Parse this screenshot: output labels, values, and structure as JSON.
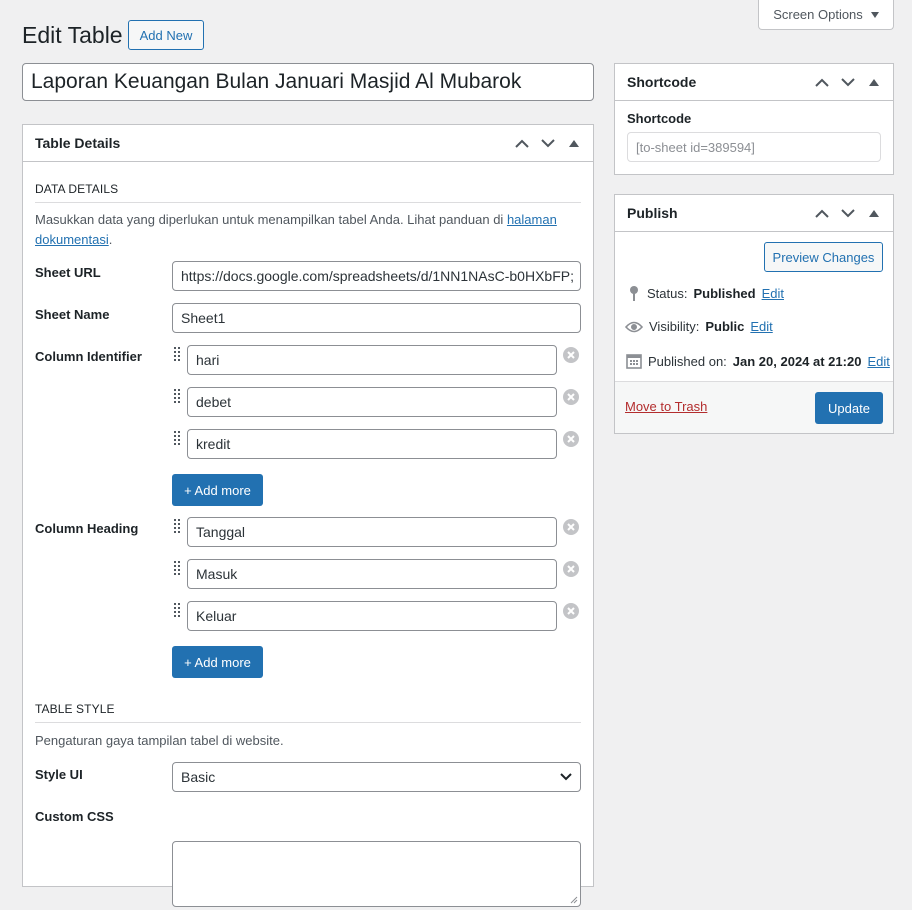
{
  "header": {
    "page_title": "Edit Table",
    "add_new_label": "Add New",
    "screen_options_label": "Screen Options"
  },
  "title_input": {
    "value": "Laporan Keuangan Bulan Januari Masjid Al Mubarok"
  },
  "table_details": {
    "heading": "Table Details",
    "data_details": {
      "title": "DATA DETAILS",
      "description_prefix": "Masukkan data yang diperlukan untuk menampilkan tabel Anda. Lihat panduan di ",
      "description_link": "halaman dokumentasi",
      "description_suffix": "."
    },
    "sheet_url": {
      "label": "Sheet URL",
      "value": "https://docs.google.com/spreadsheets/d/1NN1NAsC-b0HXbFP;"
    },
    "sheet_name": {
      "label": "Sheet Name",
      "value": "Sheet1"
    },
    "column_identifier": {
      "label": "Column Identifier",
      "values": [
        "hari",
        "debet",
        "kredit"
      ],
      "add_more_label": "+ Add more"
    },
    "column_heading": {
      "label": "Column Heading",
      "values": [
        "Tanggal",
        "Masuk",
        "Keluar"
      ],
      "add_more_label": "+ Add more"
    },
    "table_style": {
      "title": "TABLE STYLE",
      "description": "Pengaturan gaya tampilan tabel di website.",
      "style_ui": {
        "label": "Style UI",
        "value": "Basic"
      },
      "custom_css": {
        "label": "Custom CSS",
        "value": ""
      }
    }
  },
  "shortcode_box": {
    "heading": "Shortcode",
    "label": "Shortcode",
    "value": "[to-sheet id=389594]"
  },
  "publish_box": {
    "heading": "Publish",
    "preview_label": "Preview Changes",
    "status_label": "Status:",
    "status_value": "Published",
    "visibility_label": "Visibility:",
    "visibility_value": "Public",
    "published_label": "Published on:",
    "published_value": "Jan 20, 2024 at 21:20",
    "edit_label": "Edit",
    "trash_label": "Move to Trash",
    "update_label": "Update"
  },
  "colors": {
    "accent": "#2271b1",
    "background": "#f0f0f1",
    "trash": "#b32d2e"
  }
}
